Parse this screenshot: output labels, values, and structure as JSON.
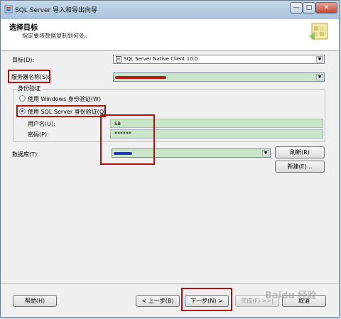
{
  "window": {
    "title": "SQL Server 导入和导出向导",
    "min_glyph": "—",
    "max_glyph": "□",
    "close_glyph": "✕"
  },
  "header": {
    "title": "选择目标",
    "subtitle": "指定要将数据复制到何处。"
  },
  "form": {
    "destination_label": "目标(D):",
    "destination_value": "SQL Server Native Client 10.0",
    "server_label": "服务器名称(S):",
    "auth_group_label": "身份验证",
    "windows_auth_label": "使用 Windows 身份验证(W)",
    "sql_auth_label": "使用 SQL Server 身份验证(Q)",
    "username_label": "用户名(U):",
    "username_value": "sa",
    "password_label": "密码(P):",
    "password_value": "******",
    "database_label": "数据库(T):",
    "refresh_label": "刷新(R)",
    "new_label": "新建(E)..."
  },
  "footer": {
    "help_label": "帮助(H)",
    "back_label": "< 上一步(B)",
    "next_label": "下一步(N) >",
    "finish_label": "完成(F) >>|",
    "cancel_label": "取消"
  },
  "watermark": "Baidu 经验",
  "colors": {
    "field_green": "#c9e7c8",
    "highlight_red": "#b01010"
  }
}
